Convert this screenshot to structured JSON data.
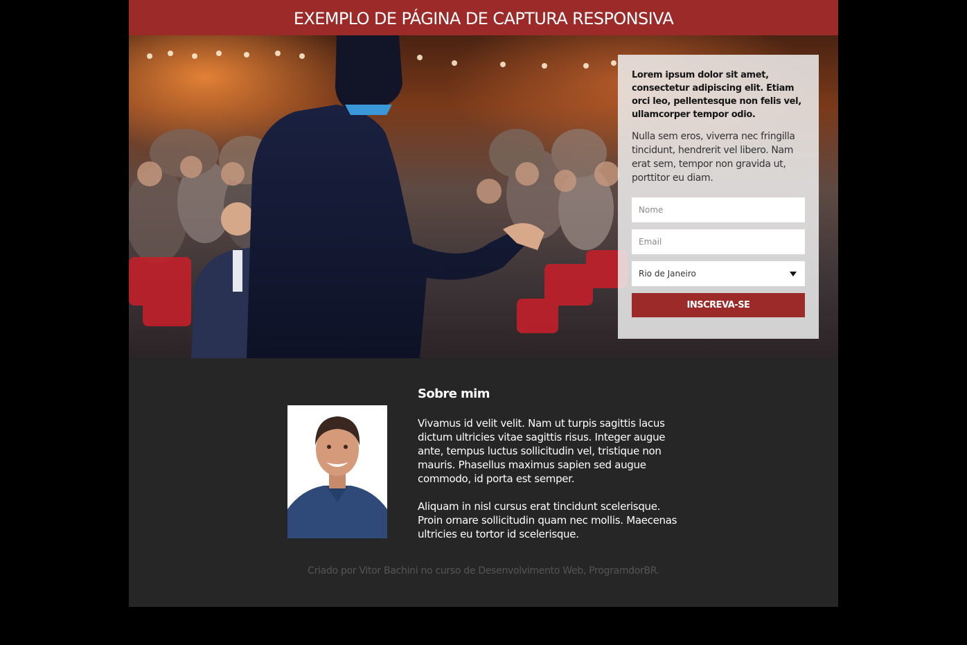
{
  "header": {
    "title": "EXEMPLO DE PÁGINA DE CAPTURA RESPONSIVA"
  },
  "form": {
    "lead": "Lorem ipsum dolor sit amet, consectetur adipiscing elit. Etiam orci leo, pellentesque non felis vel, ullamcorper tempor odio.",
    "description": "Nulla sem eros, viverra nec fringilla tincidunt, hendrerit vel libero. Nam erat sem, tempor non gravida ut, porttitor eu diam.",
    "name_placeholder": "Nome",
    "email_placeholder": "Email",
    "city_selected": "Rio de Janeiro",
    "submit_label": "INSCREVA-SE"
  },
  "about": {
    "title": "Sobre mim",
    "paragraph1": "Vivamus id velit velit. Nam ut turpis sagittis lacus dictum ultricies vitae sagittis risus. Integer augue ante, tempus luctus sollicitudin vel, tristique non mauris. Phasellus maximus sapien sed augue commodo, id porta est semper.",
    "paragraph2": "Aliquam in nisl cursus erat tincidunt scelerisque. Proin ornare sollicitudin quam nec mollis. Maecenas ultricies eu tortor id scelerisque."
  },
  "footer": {
    "credit": "Criado por Vitor Bachini no curso de Desenvolvimento Web, ProgramdorBR."
  },
  "colors": {
    "brand": "#9b2a28",
    "page_background": "#262626",
    "outer_background": "#000000"
  },
  "icons": {
    "select_arrow": "chevron-down-icon"
  }
}
